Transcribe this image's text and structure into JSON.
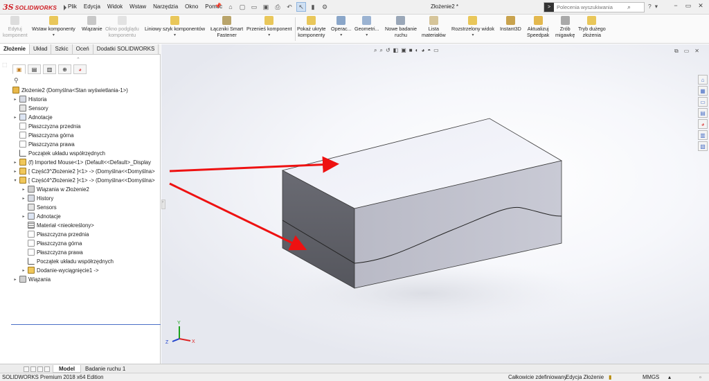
{
  "app": {
    "brand": "SOLIDWORKS",
    "brand_prefix": "3S",
    "document_title": "Złożenie2 *",
    "menus": [
      "Plik",
      "Edycja",
      "Widok",
      "Wstaw",
      "Narzędzia",
      "Okno",
      "Pomoc"
    ],
    "search_placeholder": "Polecenia wyszukiwania"
  },
  "commands": [
    {
      "label1": "Edytuj",
      "label2": "komponent",
      "disabled": true
    },
    {
      "label1": "Wstaw komponenty",
      "label2": "",
      "disabled": false
    },
    {
      "label1": "Wiązanie",
      "label2": "",
      "disabled": false
    },
    {
      "label1": "Okno podglądu",
      "label2": "komponentu",
      "disabled": true
    },
    {
      "label1": "Liniowy szyk komponentów",
      "label2": "",
      "disabled": false
    },
    {
      "label1": "Łączniki Smart",
      "label2": "Fastener",
      "disabled": false
    },
    {
      "label1": "Przenieś komponent",
      "label2": "",
      "disabled": false
    },
    {
      "label1": "Pokaż ukryte",
      "label2": "komponenty",
      "disabled": false
    },
    {
      "label1": "Operac...",
      "label2": "",
      "disabled": false
    },
    {
      "label1": "Geometri...",
      "label2": "",
      "disabled": false
    },
    {
      "label1": "Nowe badanie",
      "label2": "ruchu",
      "disabled": false
    },
    {
      "label1": "Lista",
      "label2": "materiałów",
      "disabled": false
    },
    {
      "label1": "Rozstrzelony widok",
      "label2": "",
      "disabled": false
    },
    {
      "label1": "Instant3D",
      "label2": "",
      "disabled": false
    },
    {
      "label1": "Aktualizuj",
      "label2": "Speedpak",
      "disabled": false
    },
    {
      "label1": "Zrób",
      "label2": "migawkę",
      "disabled": false
    },
    {
      "label1": "Tryb dużego",
      "label2": "złożenia",
      "disabled": false
    }
  ],
  "panel_tabs": [
    "Złożenie",
    "Układ",
    "Szkic",
    "Oceń",
    "Dodatki SOLIDWORKS"
  ],
  "tree": [
    {
      "label": "Złożenie2  (Domyślna<Stan wyświetlania-1>)",
      "icon": "assembly-icon"
    },
    {
      "label": "Historia",
      "icon": "history-icon"
    },
    {
      "label": "Sensory",
      "icon": "sensors-icon"
    },
    {
      "label": "Adnotacje",
      "icon": "annotations-icon"
    },
    {
      "label": "Płaszczyzna przednia",
      "icon": "plane-icon"
    },
    {
      "label": "Płaszczyzna górna",
      "icon": "plane-icon"
    },
    {
      "label": "Płaszczyzna prawa",
      "icon": "plane-icon"
    },
    {
      "label": "Początek układu współrzędnych",
      "icon": "origin-icon"
    },
    {
      "label": "(f) Imported Mouse<1> (Default<<Default>_Display",
      "icon": "part-icon"
    },
    {
      "label": "[ Część3^Złożenie2 ]<1> -> (Domyślna<<Domyślna>",
      "icon": "part-icon"
    },
    {
      "label": "[ Część4^Złożenie2 ]<1> -> (Domyślna<<Domyślna>",
      "icon": "part-icon"
    },
    {
      "label": "Wiązania w Złożenie2",
      "icon": "mates-icon"
    },
    {
      "label": "History",
      "icon": "history-icon"
    },
    {
      "label": "Sensors",
      "icon": "sensors-icon"
    },
    {
      "label": "Adnotacje",
      "icon": "annotations-icon"
    },
    {
      "label": "Materiał <nieokreślony>",
      "icon": "material-icon"
    },
    {
      "label": "Płaszczyzna przednia",
      "icon": "plane-icon"
    },
    {
      "label": "Płaszczyzna górna",
      "icon": "plane-icon"
    },
    {
      "label": "Płaszczyzna prawa",
      "icon": "plane-icon"
    },
    {
      "label": "Początek układu współrzędnych",
      "icon": "origin-icon"
    },
    {
      "label": "Dodanie-wyciągnięcie1 ->",
      "icon": "extrude-icon"
    },
    {
      "label": "Wiązania",
      "icon": "mates-icon"
    }
  ],
  "bottom_tabs": [
    "Model",
    "Badanie ruchu 1"
  ],
  "status": {
    "edition": "SOLIDWORKS Premium 2018 x64 Edition",
    "definition": "Całkowicie zdefiniowany",
    "mode": "Edycja Złożenie",
    "units": "MMGS"
  },
  "triad": {
    "x": "X",
    "y": "Y",
    "z": "Z"
  },
  "colors": {
    "brand_red": "#cf1f25",
    "arrow_red": "#ee1111",
    "tree_selection": "#4a6fc6"
  }
}
